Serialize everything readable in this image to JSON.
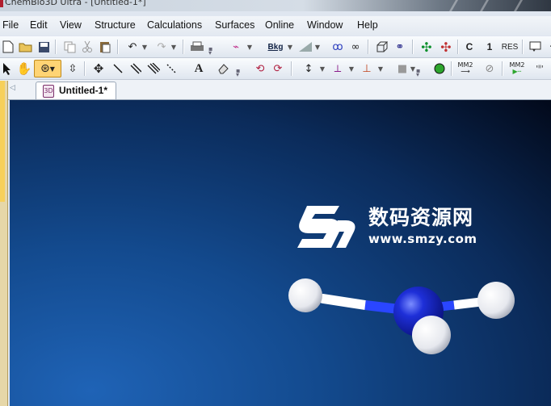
{
  "window": {
    "title": "ChemBio3D Ultra - [Untitled-1*]"
  },
  "menu": {
    "file": "File",
    "edit": "Edit",
    "view": "View",
    "structure": "Structure",
    "calculations": "Calculations",
    "surfaces": "Surfaces",
    "online": "Online",
    "window": "Window",
    "help": "Help"
  },
  "toolbar1": {
    "bkg_label": "Bkg",
    "c_label": "C",
    "one_label": "1",
    "res_label": "RES"
  },
  "toolbar2": {
    "text_tool_label": "A",
    "mm2_label": "MM2",
    "mm2_play_label": "MM2"
  },
  "tabs": [
    {
      "label": "Untitled-1*",
      "active": true
    }
  ],
  "watermark": {
    "chinese_text": "数码资源网",
    "url": "www.smzy.com"
  },
  "colors": {
    "viewport_bg": "#134a8e",
    "nitrogen_atom": "#1e2fd8",
    "hydrogen_atom": "#ffffff",
    "bond_blue": "#2a46ff"
  },
  "icons": [
    "new-icon",
    "open-icon",
    "save-icon",
    "copy-icon",
    "cut-icon",
    "paste-icon",
    "undo-icon",
    "redo-icon",
    "print-icon",
    "select-icon",
    "hand-icon",
    "rotate-icon",
    "move-icon",
    "bond-tool-icon",
    "eraser-icon"
  ]
}
